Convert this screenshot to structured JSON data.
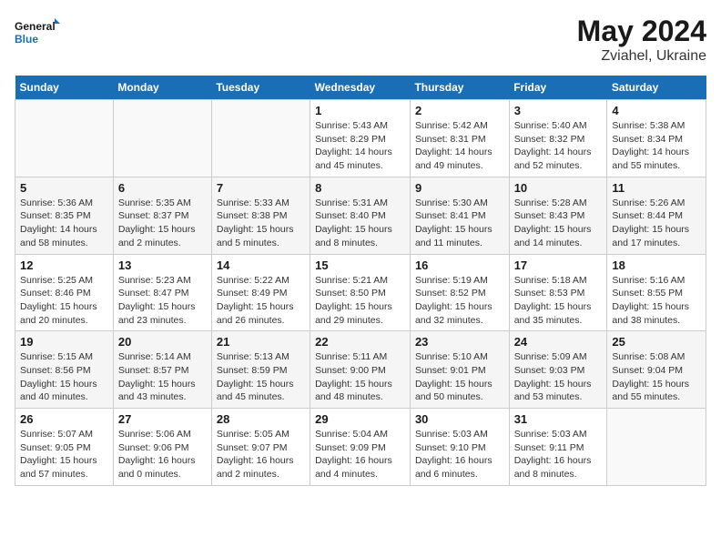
{
  "header": {
    "logo_text_general": "General",
    "logo_text_blue": "Blue",
    "month_year": "May 2024",
    "location": "Zviahel, Ukraine"
  },
  "days_of_week": [
    "Sunday",
    "Monday",
    "Tuesday",
    "Wednesday",
    "Thursday",
    "Friday",
    "Saturday"
  ],
  "weeks": [
    [
      {
        "day": "",
        "info": ""
      },
      {
        "day": "",
        "info": ""
      },
      {
        "day": "",
        "info": ""
      },
      {
        "day": "1",
        "info": "Sunrise: 5:43 AM\nSunset: 8:29 PM\nDaylight: 14 hours\nand 45 minutes."
      },
      {
        "day": "2",
        "info": "Sunrise: 5:42 AM\nSunset: 8:31 PM\nDaylight: 14 hours\nand 49 minutes."
      },
      {
        "day": "3",
        "info": "Sunrise: 5:40 AM\nSunset: 8:32 PM\nDaylight: 14 hours\nand 52 minutes."
      },
      {
        "day": "4",
        "info": "Sunrise: 5:38 AM\nSunset: 8:34 PM\nDaylight: 14 hours\nand 55 minutes."
      }
    ],
    [
      {
        "day": "5",
        "info": "Sunrise: 5:36 AM\nSunset: 8:35 PM\nDaylight: 14 hours\nand 58 minutes."
      },
      {
        "day": "6",
        "info": "Sunrise: 5:35 AM\nSunset: 8:37 PM\nDaylight: 15 hours\nand 2 minutes."
      },
      {
        "day": "7",
        "info": "Sunrise: 5:33 AM\nSunset: 8:38 PM\nDaylight: 15 hours\nand 5 minutes."
      },
      {
        "day": "8",
        "info": "Sunrise: 5:31 AM\nSunset: 8:40 PM\nDaylight: 15 hours\nand 8 minutes."
      },
      {
        "day": "9",
        "info": "Sunrise: 5:30 AM\nSunset: 8:41 PM\nDaylight: 15 hours\nand 11 minutes."
      },
      {
        "day": "10",
        "info": "Sunrise: 5:28 AM\nSunset: 8:43 PM\nDaylight: 15 hours\nand 14 minutes."
      },
      {
        "day": "11",
        "info": "Sunrise: 5:26 AM\nSunset: 8:44 PM\nDaylight: 15 hours\nand 17 minutes."
      }
    ],
    [
      {
        "day": "12",
        "info": "Sunrise: 5:25 AM\nSunset: 8:46 PM\nDaylight: 15 hours\nand 20 minutes."
      },
      {
        "day": "13",
        "info": "Sunrise: 5:23 AM\nSunset: 8:47 PM\nDaylight: 15 hours\nand 23 minutes."
      },
      {
        "day": "14",
        "info": "Sunrise: 5:22 AM\nSunset: 8:49 PM\nDaylight: 15 hours\nand 26 minutes."
      },
      {
        "day": "15",
        "info": "Sunrise: 5:21 AM\nSunset: 8:50 PM\nDaylight: 15 hours\nand 29 minutes."
      },
      {
        "day": "16",
        "info": "Sunrise: 5:19 AM\nSunset: 8:52 PM\nDaylight: 15 hours\nand 32 minutes."
      },
      {
        "day": "17",
        "info": "Sunrise: 5:18 AM\nSunset: 8:53 PM\nDaylight: 15 hours\nand 35 minutes."
      },
      {
        "day": "18",
        "info": "Sunrise: 5:16 AM\nSunset: 8:55 PM\nDaylight: 15 hours\nand 38 minutes."
      }
    ],
    [
      {
        "day": "19",
        "info": "Sunrise: 5:15 AM\nSunset: 8:56 PM\nDaylight: 15 hours\nand 40 minutes."
      },
      {
        "day": "20",
        "info": "Sunrise: 5:14 AM\nSunset: 8:57 PM\nDaylight: 15 hours\nand 43 minutes."
      },
      {
        "day": "21",
        "info": "Sunrise: 5:13 AM\nSunset: 8:59 PM\nDaylight: 15 hours\nand 45 minutes."
      },
      {
        "day": "22",
        "info": "Sunrise: 5:11 AM\nSunset: 9:00 PM\nDaylight: 15 hours\nand 48 minutes."
      },
      {
        "day": "23",
        "info": "Sunrise: 5:10 AM\nSunset: 9:01 PM\nDaylight: 15 hours\nand 50 minutes."
      },
      {
        "day": "24",
        "info": "Sunrise: 5:09 AM\nSunset: 9:03 PM\nDaylight: 15 hours\nand 53 minutes."
      },
      {
        "day": "25",
        "info": "Sunrise: 5:08 AM\nSunset: 9:04 PM\nDaylight: 15 hours\nand 55 minutes."
      }
    ],
    [
      {
        "day": "26",
        "info": "Sunrise: 5:07 AM\nSunset: 9:05 PM\nDaylight: 15 hours\nand 57 minutes."
      },
      {
        "day": "27",
        "info": "Sunrise: 5:06 AM\nSunset: 9:06 PM\nDaylight: 16 hours\nand 0 minutes."
      },
      {
        "day": "28",
        "info": "Sunrise: 5:05 AM\nSunset: 9:07 PM\nDaylight: 16 hours\nand 2 minutes."
      },
      {
        "day": "29",
        "info": "Sunrise: 5:04 AM\nSunset: 9:09 PM\nDaylight: 16 hours\nand 4 minutes."
      },
      {
        "day": "30",
        "info": "Sunrise: 5:03 AM\nSunset: 9:10 PM\nDaylight: 16 hours\nand 6 minutes."
      },
      {
        "day": "31",
        "info": "Sunrise: 5:03 AM\nSunset: 9:11 PM\nDaylight: 16 hours\nand 8 minutes."
      },
      {
        "day": "",
        "info": ""
      }
    ]
  ]
}
